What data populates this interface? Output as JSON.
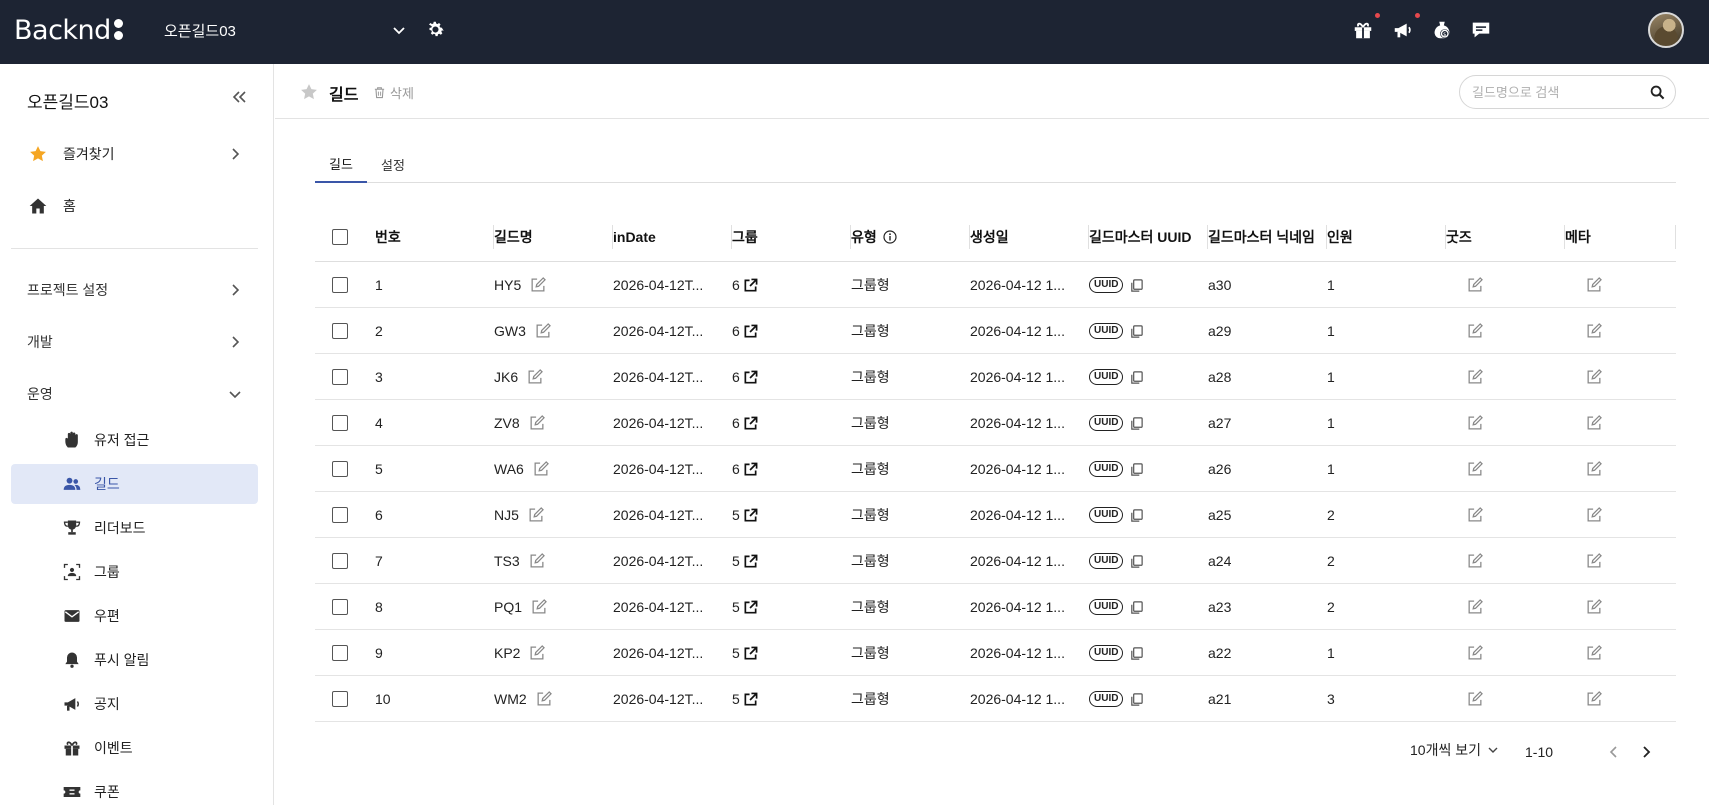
{
  "app": {
    "logo_text": "Backnd",
    "project_name": "오픈길드03"
  },
  "topbar": {
    "icons": [
      "gift-icon",
      "megaphone-icon",
      "dollar-icon",
      "chat-icon"
    ]
  },
  "sidebar": {
    "title": "오픈길드03",
    "favorites_label": "즐겨찾기",
    "home_label": "홈",
    "sections": [
      "프로젝트 설정",
      "개발",
      "운영"
    ],
    "items": [
      {
        "label": "유저 접근",
        "icon": "hand-icon"
      },
      {
        "label": "길드",
        "icon": "users-icon",
        "active": true
      },
      {
        "label": "리더보드",
        "icon": "trophy-icon"
      },
      {
        "label": "그룹",
        "icon": "group-icon"
      },
      {
        "label": "우편",
        "icon": "mail-icon"
      },
      {
        "label": "푸시 알림",
        "icon": "bell-icon"
      },
      {
        "label": "공지",
        "icon": "megaphone-icon"
      },
      {
        "label": "이벤트",
        "icon": "gift-icon"
      },
      {
        "label": "쿠폰",
        "icon": "ticket-icon"
      }
    ]
  },
  "header": {
    "title": "길드",
    "delete_label": "삭제",
    "search_placeholder": "길드명으로 검색"
  },
  "tabs": [
    {
      "label": "길드",
      "active": true
    },
    {
      "label": "설정",
      "active": false
    }
  ],
  "table": {
    "columns": [
      "번호",
      "길드명",
      "inDate",
      "그룹",
      "유형",
      "생성일",
      "길드마스터 UUID",
      "길드마스터 닉네임",
      "인원",
      "굿즈",
      "메타"
    ],
    "uuid_badge": "UUID",
    "rows": [
      {
        "no": "1",
        "name": "HY5",
        "indate": "2026-04-12T...",
        "group": "6",
        "type": "그룹형",
        "created": "2026-04-12 1...",
        "nickname": "a30",
        "members": "1"
      },
      {
        "no": "2",
        "name": "GW3",
        "indate": "2026-04-12T...",
        "group": "6",
        "type": "그룹형",
        "created": "2026-04-12 1...",
        "nickname": "a29",
        "members": "1"
      },
      {
        "no": "3",
        "name": "JK6",
        "indate": "2026-04-12T...",
        "group": "6",
        "type": "그룹형",
        "created": "2026-04-12 1...",
        "nickname": "a28",
        "members": "1"
      },
      {
        "no": "4",
        "name": "ZV8",
        "indate": "2026-04-12T...",
        "group": "6",
        "type": "그룹형",
        "created": "2026-04-12 1...",
        "nickname": "a27",
        "members": "1"
      },
      {
        "no": "5",
        "name": "WA6",
        "indate": "2026-04-12T...",
        "group": "6",
        "type": "그룹형",
        "created": "2026-04-12 1...",
        "nickname": "a26",
        "members": "1"
      },
      {
        "no": "6",
        "name": "NJ5",
        "indate": "2026-04-12T...",
        "group": "5",
        "type": "그룹형",
        "created": "2026-04-12 1...",
        "nickname": "a25",
        "members": "2"
      },
      {
        "no": "7",
        "name": "TS3",
        "indate": "2026-04-12T...",
        "group": "5",
        "type": "그룹형",
        "created": "2026-04-12 1...",
        "nickname": "a24",
        "members": "2"
      },
      {
        "no": "8",
        "name": "PQ1",
        "indate": "2026-04-12T...",
        "group": "5",
        "type": "그룹형",
        "created": "2026-04-12 1...",
        "nickname": "a23",
        "members": "2"
      },
      {
        "no": "9",
        "name": "KP2",
        "indate": "2026-04-12T...",
        "group": "5",
        "type": "그룹형",
        "created": "2026-04-12 1...",
        "nickname": "a22",
        "members": "1"
      },
      {
        "no": "10",
        "name": "WM2",
        "indate": "2026-04-12T...",
        "group": "5",
        "type": "그룹형",
        "created": "2026-04-12 1...",
        "nickname": "a21",
        "members": "3"
      }
    ]
  },
  "pagination": {
    "per_page_label": "10개씩 보기",
    "range": "1-10"
  },
  "colors": {
    "topbar_bg": "#1d2433",
    "accent": "#3a56a8",
    "active_item_bg": "#e2e8f7",
    "favorite_star": "#f5a623",
    "notification_dot": "#e5484d"
  }
}
